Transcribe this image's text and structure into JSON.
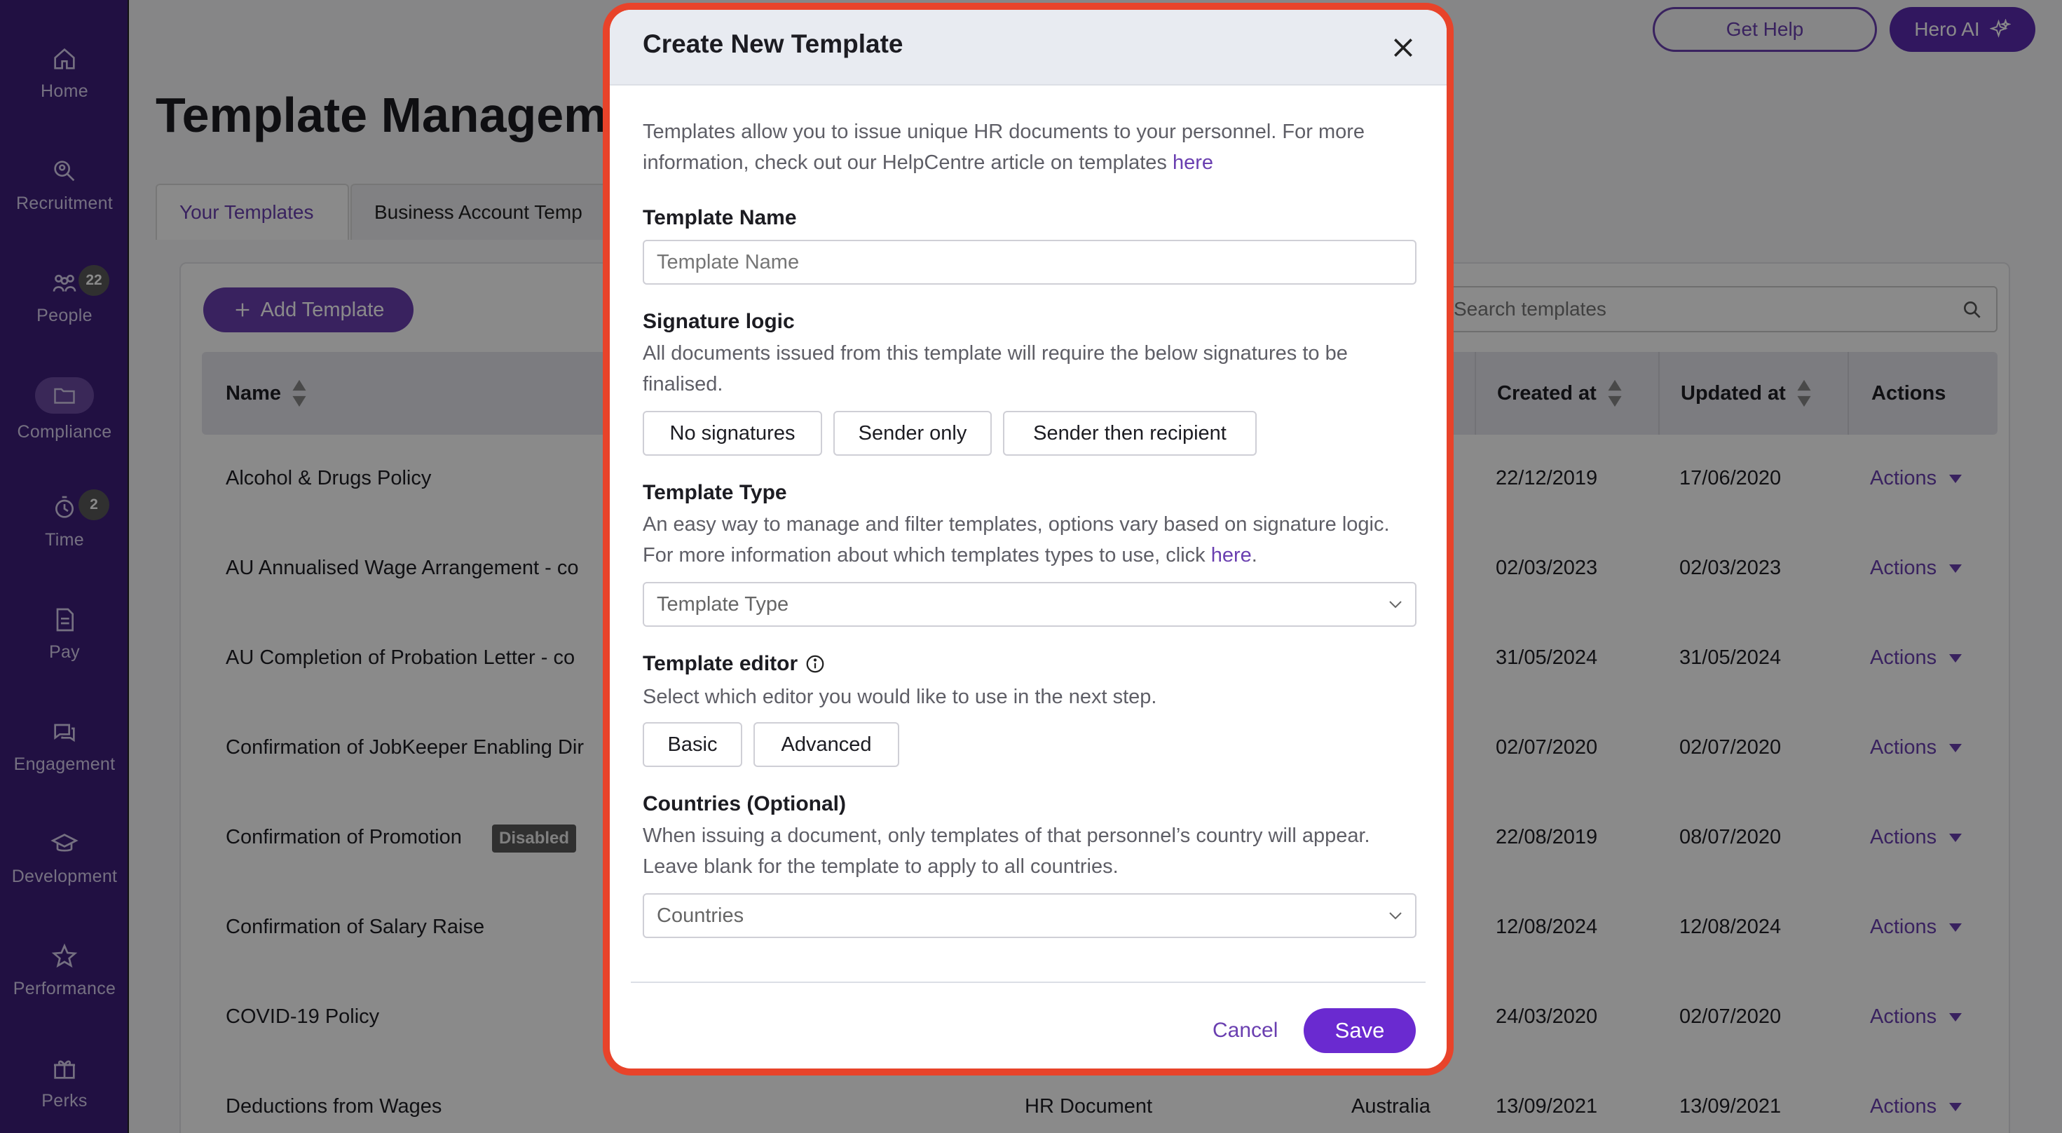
{
  "sidebar": {
    "items": [
      {
        "label": "Home",
        "icon": "home-icon"
      },
      {
        "label": "Recruitment",
        "icon": "recruitment-icon"
      },
      {
        "label": "People",
        "icon": "people-icon",
        "badge": "22"
      },
      {
        "label": "Compliance",
        "icon": "folder-icon",
        "active": true
      },
      {
        "label": "Time",
        "icon": "time-icon",
        "badge": "2"
      },
      {
        "label": "Pay",
        "icon": "pay-icon"
      },
      {
        "label": "Engagement",
        "icon": "engagement-icon"
      },
      {
        "label": "Development",
        "icon": "development-icon"
      },
      {
        "label": "Performance",
        "icon": "star-icon"
      },
      {
        "label": "Perks",
        "icon": "gift-icon"
      }
    ]
  },
  "header": {
    "get_help": "Get Help",
    "hero_ai": "Hero AI"
  },
  "page": {
    "title": "Template Manageme",
    "tabs": [
      "Your Templates",
      "Business Account Temp"
    ],
    "add_template": "Add Template",
    "search_placeholder": "Search templates"
  },
  "table": {
    "columns": [
      "Name",
      "Created at",
      "Updated at",
      "Actions"
    ],
    "rows": [
      {
        "name": "Alcohol & Drugs Policy",
        "type": "",
        "country": "",
        "created": "22/12/2019",
        "updated": "17/06/2020",
        "action": "Actions"
      },
      {
        "name": "AU Annualised Wage Arrangement - co",
        "type": "",
        "country": "",
        "created": "02/03/2023",
        "updated": "02/03/2023",
        "action": "Actions"
      },
      {
        "name": "AU Completion of Probation Letter - co",
        "type": "",
        "country": "",
        "created": "31/05/2024",
        "updated": "31/05/2024",
        "action": "Actions"
      },
      {
        "name": "Confirmation of JobKeeper Enabling Dir",
        "type": "",
        "country": "",
        "created": "02/07/2020",
        "updated": "02/07/2020",
        "action": "Actions"
      },
      {
        "name": "Confirmation of Promotion",
        "tag": "Disabled",
        "type": "",
        "country": "",
        "created": "22/08/2019",
        "updated": "08/07/2020",
        "action": "Actions"
      },
      {
        "name": "Confirmation of Salary Raise",
        "type": "",
        "country": "",
        "created": "12/08/2024",
        "updated": "12/08/2024",
        "action": "Actions"
      },
      {
        "name": "COVID-19 Policy",
        "type": "",
        "country": "",
        "created": "24/03/2020",
        "updated": "02/07/2020",
        "action": "Actions"
      },
      {
        "name": "Deductions from Wages",
        "type": "HR Document",
        "country": "Australia",
        "created": "13/09/2021",
        "updated": "13/09/2021",
        "action": "Actions"
      }
    ]
  },
  "modal": {
    "title": "Create New Template",
    "intro": "Templates allow you to issue unique HR documents to your personnel. For more information, check out our HelpCentre article on templates ",
    "intro_link": "here",
    "name_label": "Template Name",
    "name_placeholder": "Template Name",
    "signature_label": "Signature logic",
    "signature_desc": "All documents issued from this template will require the below signatures to be finalised.",
    "signature_options": [
      "No signatures",
      "Sender only",
      "Sender then recipient"
    ],
    "type_label": "Template Type",
    "type_desc": "An easy way to manage and filter templates, options vary based on signature logic. For more information about which templates types to use, click ",
    "type_link": "here",
    "type_link_suffix": ".",
    "type_placeholder": "Template Type",
    "editor_label": "Template editor",
    "editor_desc": "Select which editor you would like to use in the next step.",
    "editor_options": [
      "Basic",
      "Advanced"
    ],
    "countries_label": "Countries (Optional)",
    "countries_desc": "When issuing a document, only templates of that personnel’s country will appear. Leave blank for the template to apply to all countries.",
    "countries_placeholder": "Countries",
    "cancel": "Cancel",
    "save": "Save"
  },
  "colors": {
    "sidebar": "#3d1f7a",
    "accent": "#6a3fb0",
    "save_button": "#6a2ad0",
    "highlight_ring": "#e8432a"
  }
}
